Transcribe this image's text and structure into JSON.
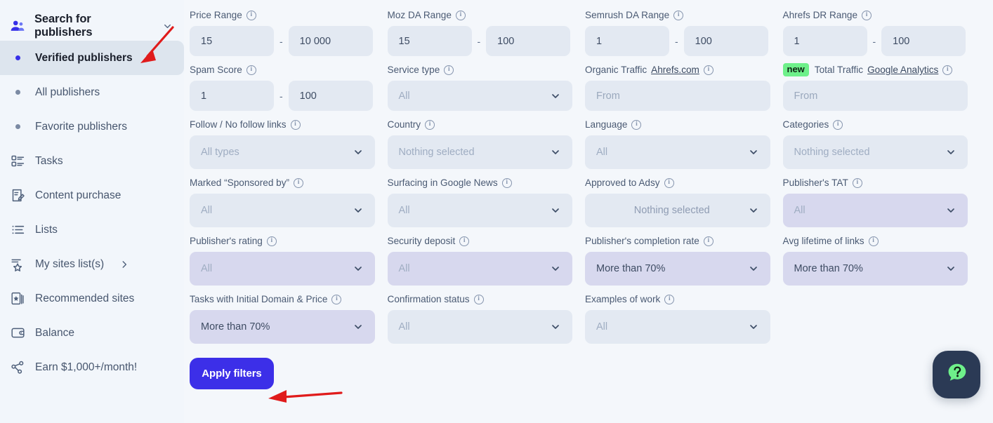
{
  "sidebar": {
    "header": {
      "label": "Search for publishers",
      "icon": "users-icon",
      "chevron": "chevron-down-icon"
    },
    "items": [
      {
        "label": "Verified publishers",
        "type": "dot",
        "active": true
      },
      {
        "label": "All publishers",
        "type": "dot",
        "active": false
      },
      {
        "label": "Favorite publishers",
        "type": "dot",
        "active": false
      },
      {
        "label": "Tasks",
        "type": "icon",
        "icon": "tasks-icon",
        "active": false
      },
      {
        "label": "Content purchase",
        "type": "icon",
        "icon": "document-edit-icon",
        "active": false
      },
      {
        "label": "Lists",
        "type": "icon",
        "icon": "list-icon",
        "active": false
      },
      {
        "label": "My sites list(s)",
        "type": "icon",
        "icon": "list-star-icon",
        "active": false,
        "arrow": "chevron-right-icon"
      },
      {
        "label": "Recommended sites",
        "type": "icon",
        "icon": "recommended-card-icon",
        "active": false
      },
      {
        "label": "Balance",
        "type": "icon",
        "icon": "wallet-icon",
        "active": false
      },
      {
        "label": "Earn $1,000+/month!",
        "type": "icon",
        "icon": "share-network-icon",
        "active": false
      }
    ]
  },
  "filters": {
    "price_range": {
      "label": "Price Range",
      "min": "15",
      "max": "10 000",
      "separator": "-"
    },
    "moz_da_range": {
      "label": "Moz DA Range",
      "min": "15",
      "max": "100",
      "separator": "-"
    },
    "semrush_da_range": {
      "label": "Semrush DA Range",
      "min": "1",
      "max": "100",
      "separator": "-"
    },
    "ahrefs_dr_range": {
      "label": "Ahrefs DR Range",
      "min": "1",
      "max": "100",
      "separator": "-"
    },
    "spam_score": {
      "label": "Spam Score",
      "min": "1",
      "max": "100",
      "separator": "-"
    },
    "service_type": {
      "label": "Service type",
      "value": "All"
    },
    "organic_traffic": {
      "label": "Organic Traffic",
      "link": "Ahrefs.com",
      "placeholder": "From"
    },
    "total_traffic": {
      "badge": "new",
      "label": "Total Traffic",
      "link": "Google Analytics",
      "placeholder": "From"
    },
    "follow_links": {
      "label": "Follow / No follow links",
      "value": "All types"
    },
    "country": {
      "label": "Country",
      "value": "Nothing selected"
    },
    "language": {
      "label": "Language",
      "value": "All"
    },
    "categories": {
      "label": "Categories",
      "value": "Nothing selected"
    },
    "marked_sponsored": {
      "label": "Marked “Sponsored by”",
      "value": "All"
    },
    "google_news": {
      "label": "Surfacing in Google News",
      "value": "All"
    },
    "approved_adsy": {
      "label": "Approved to Adsy",
      "value": "Nothing selected"
    },
    "publishers_tat": {
      "label": "Publisher's TAT",
      "value": "All"
    },
    "publishers_rating": {
      "label": "Publisher's rating",
      "value": "All"
    },
    "security_deposit": {
      "label": "Security deposit",
      "value": "All"
    },
    "completion_rate": {
      "label": "Publisher's completion rate",
      "value": "More than 70%"
    },
    "avg_lifetime": {
      "label": "Avg lifetime of links",
      "value": "More than 70%"
    },
    "initial_domain_price": {
      "label": "Tasks with Initial Domain & Price",
      "value": "More than 70%"
    },
    "confirmation_status": {
      "label": "Confirmation status",
      "value": "All"
    },
    "examples_of_work": {
      "label": "Examples of work",
      "value": "All"
    }
  },
  "actions": {
    "apply_label": "Apply filters"
  },
  "help": {
    "icon": "question-chat-icon"
  },
  "colors": {
    "accent": "#3c2fe8",
    "page_bg": "#f4f7fb",
    "sidebar_bg": "#f2f6fb",
    "field_bg": "#e3e9f2",
    "field_bg_lavender": "#d7d8ee",
    "badge_new": "#6ef08a",
    "annotation_arrow": "#e01b1b",
    "help_bg": "#2b3a55",
    "help_icon": "#6ef08a"
  }
}
